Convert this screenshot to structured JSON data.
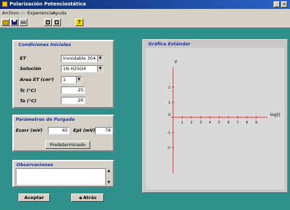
{
  "window": {
    "title": "Polarización Potenciostática",
    "minimize": "_",
    "close": "✕"
  },
  "menu": {
    "items": [
      "Archivo",
      "Ver",
      "Experiencia",
      "Ayuda"
    ]
  },
  "toolbar": {
    "help_label": "?"
  },
  "conditions": {
    "title": "Condiciones Iniciales",
    "et_label": "ET",
    "et_value": "Inoxidable 304",
    "solution_label": "Solución",
    "solution_value": "1N H2SO4",
    "area_label": "Area ET (cm²)",
    "area_value": "1",
    "tc_label": "Tc (°C)",
    "tc_value": "25",
    "ta_label": "Ta (°C)",
    "ta_value": "26"
  },
  "purge": {
    "title": "Parámetros de Purgado",
    "ecorr_label": "Ecorr (mV)",
    "ecorr_value": "45",
    "ept_label": "Ept (mV)",
    "ept_value": "78",
    "default_button": "Predeterminado"
  },
  "notes": {
    "title": "Observaciones",
    "value": ""
  },
  "actions": {
    "accept": "Aceptar",
    "back": "Atrás"
  },
  "graph": {
    "title": "Gráfica Estándar",
    "y_label": "V",
    "x_label": "log|i|",
    "x_ticks": [
      "0",
      "1",
      "2",
      "3",
      "4",
      "5",
      "6",
      "7",
      "8",
      "9"
    ],
    "y_ticks_pos": [
      "2",
      "1"
    ],
    "y_ticks_neg": [
      "-1",
      "-2"
    ],
    "axis_color": "#e03030"
  }
}
